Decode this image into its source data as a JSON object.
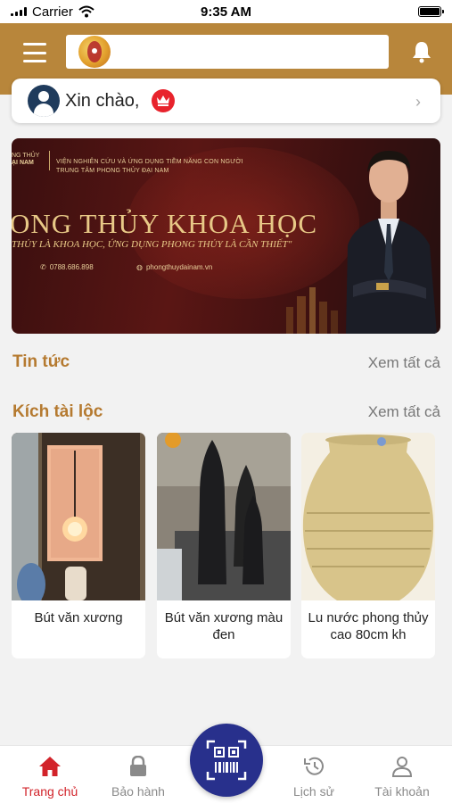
{
  "status_bar": {
    "carrier": "Carrier",
    "time": "9:35 AM"
  },
  "header": {
    "search_placeholder": ""
  },
  "greeting": {
    "text": "Xin chào,"
  },
  "banner": {
    "org_line1": "NG THỦY",
    "org_line2": "ẠI NAM",
    "institute_line1": "VIỆN NGHIÊN CỨU VÀ ỨNG DỤNG TIỀM NĂNG CON NGƯỜI",
    "institute_line2": "TRUNG TÂM PHONG THỦY ĐẠI NAM",
    "title": "ONG THỦY KHOA HỌC",
    "subtitle": "THỦY LÀ KHOA HỌC, ỨNG DỤNG PHONG THỦY LÀ CẦN THIẾT\"",
    "phone": "0788.686.898",
    "website": "phongthuydainam.vn"
  },
  "sections": {
    "news": {
      "title": "Tin tức",
      "see_all": "Xem tất cả"
    },
    "products": {
      "title": "Kích tài lộc",
      "see_all": "Xem tất cả"
    }
  },
  "products": [
    {
      "name": "Bút văn xương"
    },
    {
      "name": "Bút văn xương màu đen"
    },
    {
      "name": "Lu nước phong thủy cao 80cm kh"
    }
  ],
  "tabs": [
    {
      "label": "Trang chủ",
      "icon": "home-icon",
      "active": true
    },
    {
      "label": "Bảo hành",
      "icon": "lock-icon",
      "active": false
    },
    {
      "label": "Lịch sử",
      "icon": "history-icon",
      "active": false
    },
    {
      "label": "Tài khoản",
      "icon": "user-icon",
      "active": false
    }
  ],
  "colors": {
    "brand": "#b8863b",
    "accent_red": "#d2232a",
    "scan_button": "#28308c",
    "section_title": "#b57a30"
  }
}
